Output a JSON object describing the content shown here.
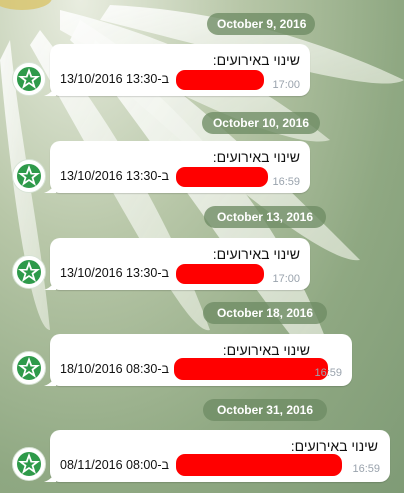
{
  "colors": {
    "date_pill_bg": "#6e8c64",
    "bubble_bg": "#ffffff",
    "redaction": "#ff0000",
    "time_text": "#9aa3ad",
    "avatar_green": "#2e9a4a"
  },
  "avatar_icon": "green-star-emblem-icon",
  "days": [
    {
      "date": "October 9, 2016",
      "message": {
        "title": "שינוי באירועים:",
        "body": "13/10/2016 ב-13:30",
        "time": "17:00"
      }
    },
    {
      "date": "October 10, 2016",
      "message": {
        "title": "שינוי באירועים:",
        "body": "13/10/2016 ב-13:30",
        "time": "16:59"
      }
    },
    {
      "date": "October 13, 2016",
      "message": {
        "title": "שינוי באירועים:",
        "body": "13/10/2016 ב-13:30",
        "time": "17:00"
      }
    },
    {
      "date": "October 18, 2016",
      "message": {
        "title": "שינוי באירועים:",
        "body": "18/10/2016 ב-08:30",
        "time": "16:59"
      }
    },
    {
      "date": "October 31, 2016",
      "message": {
        "title": "שינוי באירועים:",
        "body": "08/11/2016 ב-08:00",
        "time": "16:59"
      }
    }
  ]
}
